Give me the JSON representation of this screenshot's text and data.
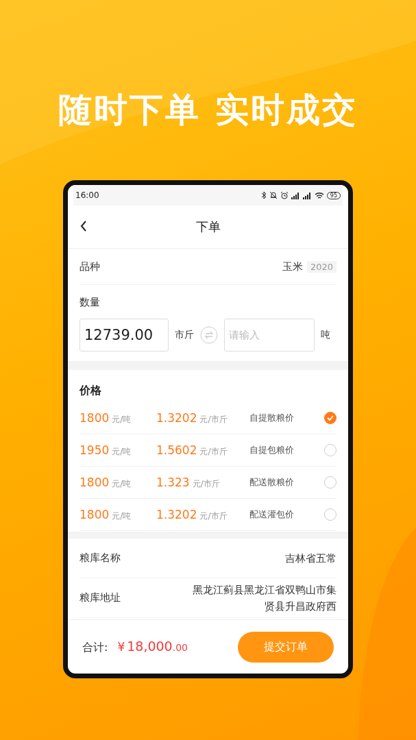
{
  "headline": "随时下单 实时成交",
  "status_bar": {
    "time": "16:00",
    "battery": "95"
  },
  "nav": {
    "title": "下单"
  },
  "variety": {
    "label": "品种",
    "value": "玉米",
    "year": "2020"
  },
  "quantity": {
    "label": "数量",
    "value": "12739.00",
    "unit_from": "市斤",
    "placeholder": "请输入",
    "unit_to": "吨"
  },
  "price": {
    "label": "价格",
    "rows": [
      {
        "ton_price": "1800",
        "ton_unit": "元/吨",
        "jin_price": "1.3202",
        "jin_unit": "元/市斤",
        "type": "自提散粮价",
        "selected": true
      },
      {
        "ton_price": "1950",
        "ton_unit": "元/吨",
        "jin_price": "1.5602",
        "jin_unit": "元/市斤",
        "type": "自提包粮价",
        "selected": false
      },
      {
        "ton_price": "1800",
        "ton_unit": "元/吨",
        "jin_price": "1.323",
        "jin_unit": "元/市斤",
        "type": "配送散粮价",
        "selected": false
      },
      {
        "ton_price": "1800",
        "ton_unit": "元/吨",
        "jin_price": "1.3202",
        "jin_unit": "元/市斤",
        "type": "配送灌包价",
        "selected": false
      }
    ]
  },
  "warehouse": [
    {
      "label": "粮库名称",
      "value": "吉林省五常"
    },
    {
      "label": "粮库地址",
      "value": "黑龙江蓟县黑龙江省双鸭山市集贤县升昌政府西"
    }
  ],
  "footer": {
    "total_label": "合计:",
    "currency": "¥",
    "amount": "18,000",
    "decimals": ".00",
    "submit": "提交订单"
  }
}
